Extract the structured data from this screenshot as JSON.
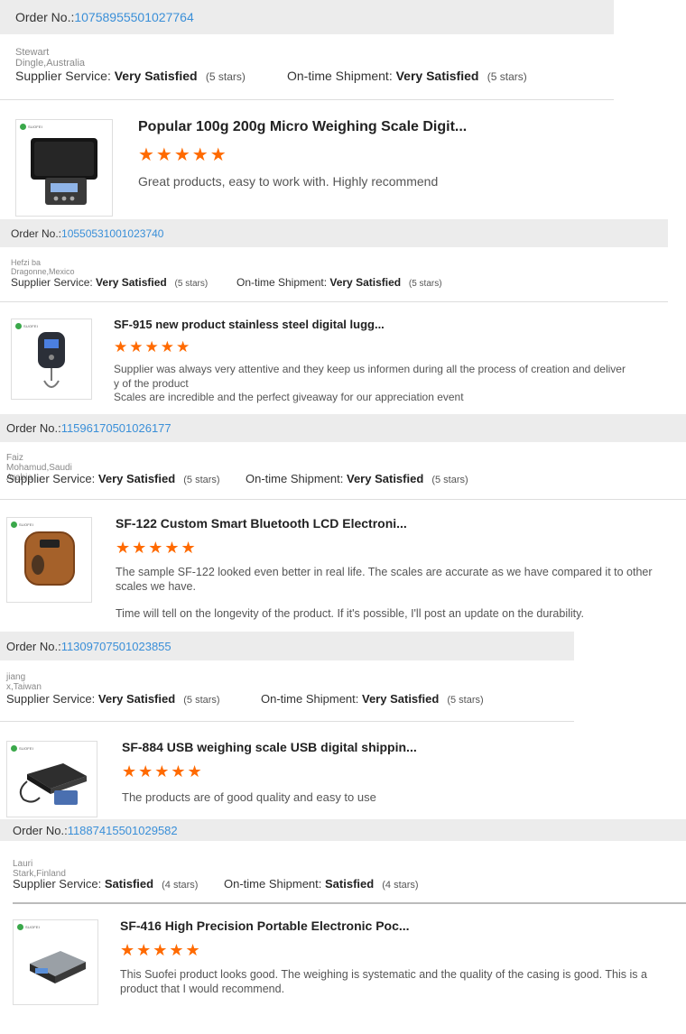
{
  "order_label": "Order No.:",
  "supplier_label": "Supplier Service:",
  "shipment_label": "On-time Shipment:",
  "star_glyphs": "★★★★★",
  "accent_color": "#ff6a00",
  "link_color": "#3a8fd8",
  "logo_text": "SUOFEI",
  "reviews": [
    {
      "order_no": "10758955501027764",
      "buyer": "Stewart Dingle,Australia",
      "supplier_rating": "Very Satisfied",
      "supplier_stars": "(5 stars)",
      "shipment_rating": "Very Satisfied",
      "shipment_stars": "(5 stars)",
      "product_title": "Popular 100g 200g Micro Weighing Scale Digit...",
      "product_rating": 5,
      "comment": [
        "Great products, easy to work with. Highly recommend"
      ]
    },
    {
      "order_no": "10550531001023740",
      "buyer": "Hefzi ba Dragonne,Mexico",
      "supplier_rating": "Very Satisfied",
      "supplier_stars": "(5 stars)",
      "shipment_rating": "Very Satisfied",
      "shipment_stars": "(5 stars)",
      "product_title": "SF-915 new product stainless steel digital lugg...",
      "product_rating": 5,
      "comment": [
        "Supplier was always very attentive and they keep us informen during all the process of creation and deliver",
        "y of the product",
        "Scales are incredible and the perfect giveaway for our appreciation event"
      ]
    },
    {
      "order_no": "11596170501026177",
      "buyer": "Faiz Mohamud,Saudi Arabia",
      "supplier_rating": "Very Satisfied",
      "supplier_stars": "(5 stars)",
      "shipment_rating": "Very Satisfied",
      "shipment_stars": "(5 stars)",
      "product_title": "SF-122 Custom Smart Bluetooth LCD Electroni...",
      "product_rating": 5,
      "comment": [
        "The sample SF-122 looked even better in real life. The scales are accurate as we have compared it to other scales we have.",
        "",
        "Time will tell on the longevity of the product. If it's possible, I'll post an update on the durability."
      ]
    },
    {
      "order_no": "11309707501023855",
      "buyer": "jiang x,Taiwan",
      "supplier_rating": "Very Satisfied",
      "supplier_stars": "(5 stars)",
      "shipment_rating": "Very Satisfied",
      "shipment_stars": "(5 stars)",
      "product_title": "SF-884 USB weighing scale USB digital shippin...",
      "product_rating": 5,
      "comment": [
        "The products are of good quality and easy to use"
      ]
    },
    {
      "order_no": "11887415501029582",
      "buyer": "Lauri Stark,Finland",
      "supplier_rating": "Satisfied",
      "supplier_stars": "(4 stars)",
      "shipment_rating": "Satisfied",
      "shipment_stars": "(4 stars)",
      "product_title": "SF-416 High Precision Portable Electronic Poc...",
      "product_rating": 5,
      "comment": [
        "This Suofei product looks good. The weighing is systematic and the quality of the casing is good. This is a product that I would recommend."
      ]
    }
  ]
}
